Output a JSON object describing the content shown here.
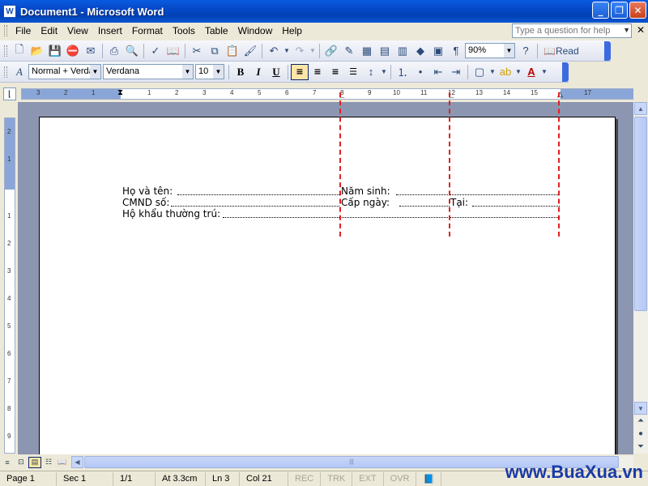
{
  "window": {
    "title": "Document1 - Microsoft Word",
    "app_icon": "word-icon"
  },
  "menu": {
    "items": [
      "File",
      "Edit",
      "View",
      "Insert",
      "Format",
      "Tools",
      "Table",
      "Window",
      "Help"
    ],
    "ask_placeholder": "Type a question for help"
  },
  "toolbar_standard": {
    "zoom": "90%",
    "read_label": "Read"
  },
  "toolbar_formatting": {
    "style": "Normal + Verda",
    "font": "Verdana",
    "size": "10"
  },
  "ruler": {
    "h_labels": [
      "3",
      "2",
      "1",
      "1",
      "2",
      "3",
      "4",
      "5",
      "6",
      "7",
      "8",
      "9",
      "10",
      "11",
      "12",
      "13",
      "14",
      "15",
      "17"
    ],
    "v_labels": [
      "2",
      "1",
      "1",
      "2",
      "3",
      "4",
      "5",
      "6",
      "7",
      "8",
      "9"
    ]
  },
  "document": {
    "line1": {
      "label1": "Họ và tên:",
      "label2": "Năm sinh:"
    },
    "line2": {
      "label1": "CMND số:",
      "label2": "Cấp ngày:",
      "label3": "Tại:"
    },
    "line3": {
      "label1": "Hộ khẩu thường trú:"
    }
  },
  "statusbar": {
    "page": "Page 1",
    "sec": "Sec 1",
    "pages": "1/1",
    "at": "At 3.3cm",
    "ln": "Ln 3",
    "col": "Col 21",
    "flags": [
      "REC",
      "TRK",
      "EXT",
      "OVR"
    ]
  },
  "watermark": "www.BuaXua.vn",
  "colors": {
    "title_bar": "#0548c7",
    "tab_guide": "#e02020",
    "watermark": "#1a3aa8"
  }
}
